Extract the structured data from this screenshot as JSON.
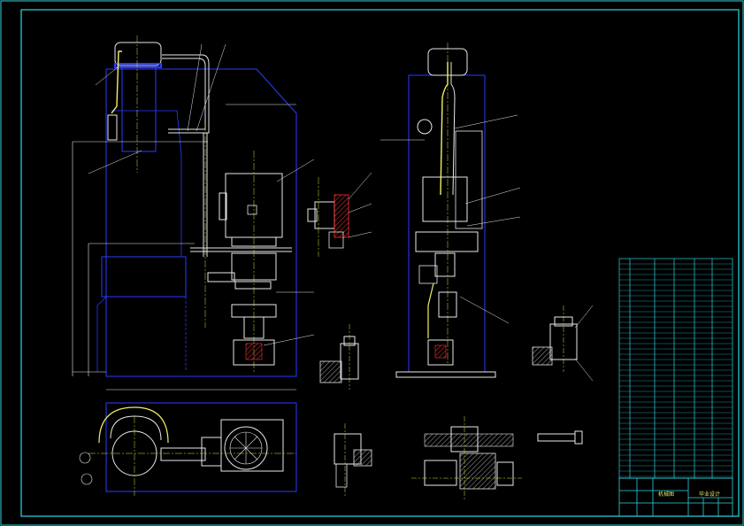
{
  "drawing": {
    "background": "#000000",
    "colors": {
      "frame": "#2fd4e0",
      "outline": "#e8e8e8",
      "housing": "#2a3cff",
      "center": "#e0e040",
      "hatch": "#ff3030",
      "pipe": "#f0f060"
    },
    "title_block": {
      "company": "机械图",
      "title": "毕业设计"
    }
  }
}
